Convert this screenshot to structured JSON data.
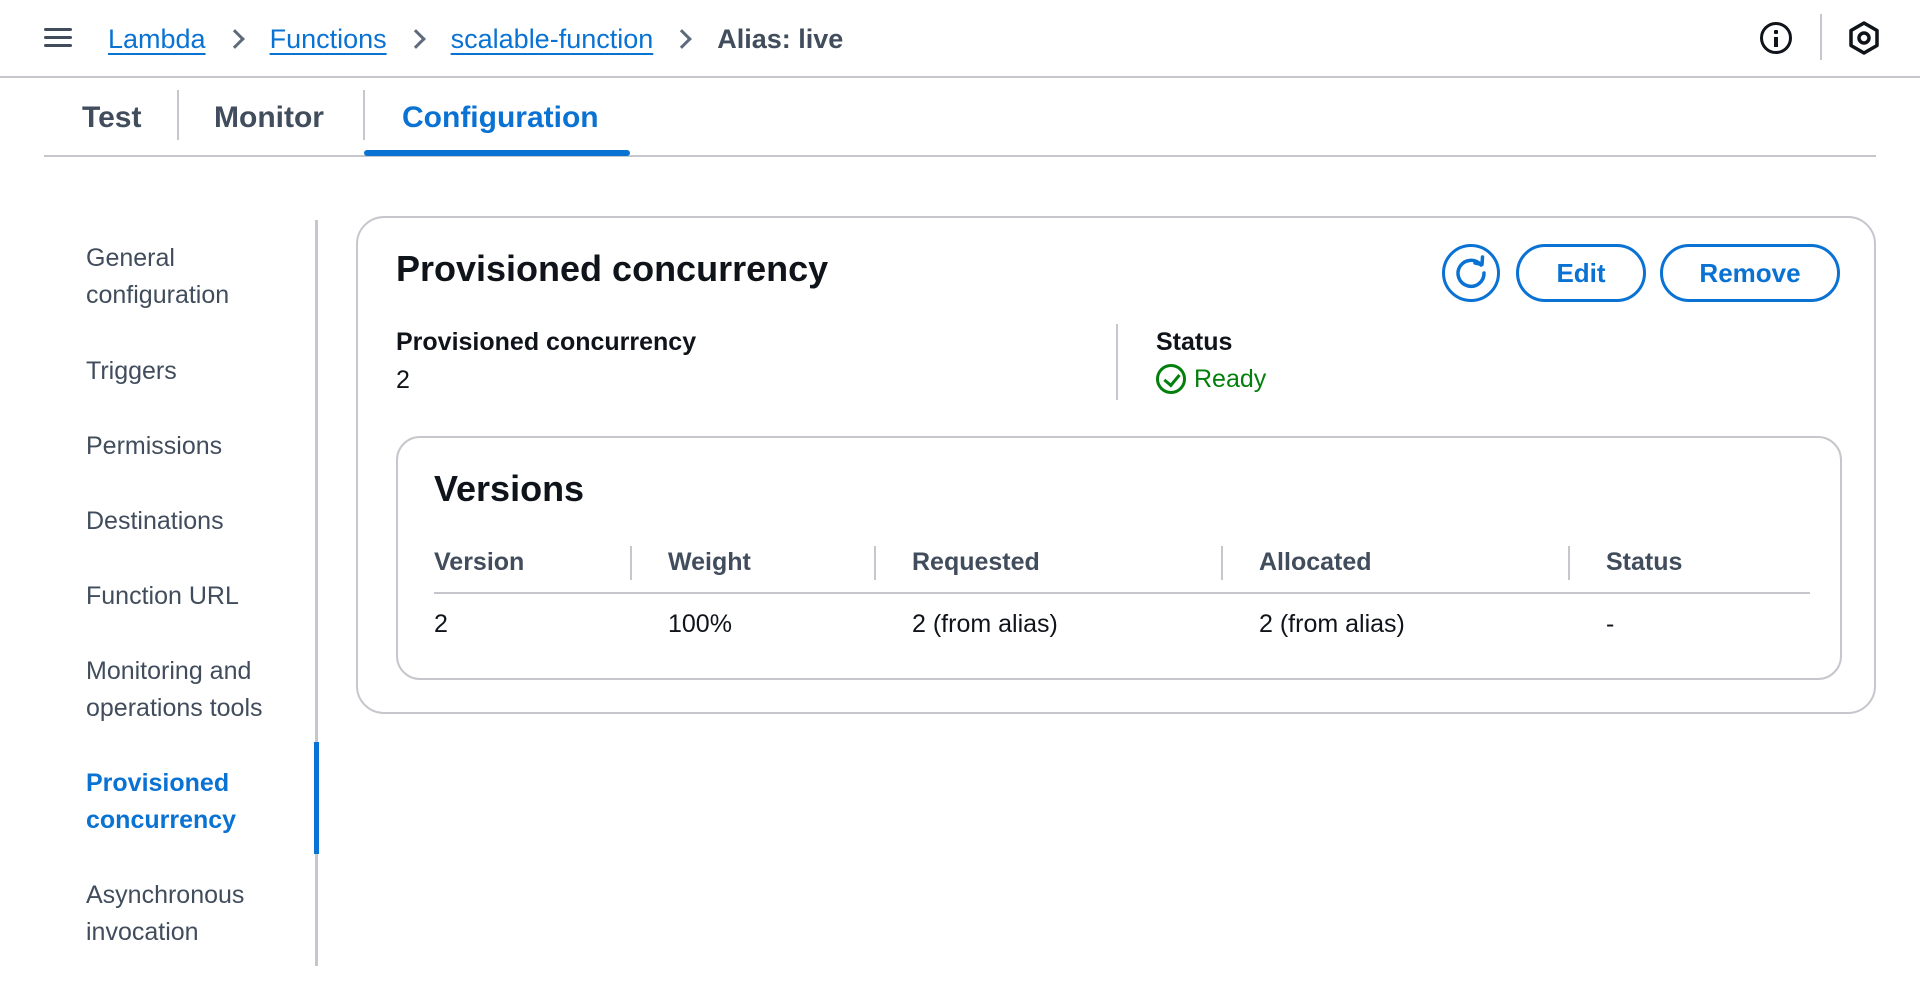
{
  "breadcrumb": {
    "items": [
      "Lambda",
      "Functions",
      "scalable-function"
    ],
    "current": "Alias: live"
  },
  "header_icons": [
    "menu-icon",
    "info-icon",
    "settings-icon"
  ],
  "tabs": [
    {
      "label": "Test",
      "active": false
    },
    {
      "label": "Monitor",
      "active": false
    },
    {
      "label": "Configuration",
      "active": true
    }
  ],
  "sidenav": {
    "items": [
      {
        "label": "General configuration",
        "active": false
      },
      {
        "label": "Triggers",
        "active": false
      },
      {
        "label": "Permissions",
        "active": false
      },
      {
        "label": "Destinations",
        "active": false
      },
      {
        "label": "Function URL",
        "active": false
      },
      {
        "label": "Monitoring and operations tools",
        "active": false
      },
      {
        "label": "Provisioned concurrency",
        "active": true
      },
      {
        "label": "Asynchronous invocation",
        "active": false
      }
    ]
  },
  "panel": {
    "title": "Provisioned concurrency",
    "edit_label": "Edit",
    "remove_label": "Remove",
    "concurrency_label": "Provisioned concurrency",
    "concurrency_value": "2",
    "status_label": "Status",
    "status_value": "Ready"
  },
  "versions": {
    "title": "Versions",
    "columns": [
      "Version",
      "Weight",
      "Requested",
      "Allocated",
      "Status"
    ],
    "rows": [
      [
        "2",
        "100%",
        "2 (from alias)",
        "2 (from alias)",
        "-"
      ]
    ]
  },
  "colors": {
    "accent": "#0972d3",
    "success": "#037f0c",
    "border": "#c6c6cd",
    "text": "#0f141a",
    "muted": "#414d5c"
  }
}
